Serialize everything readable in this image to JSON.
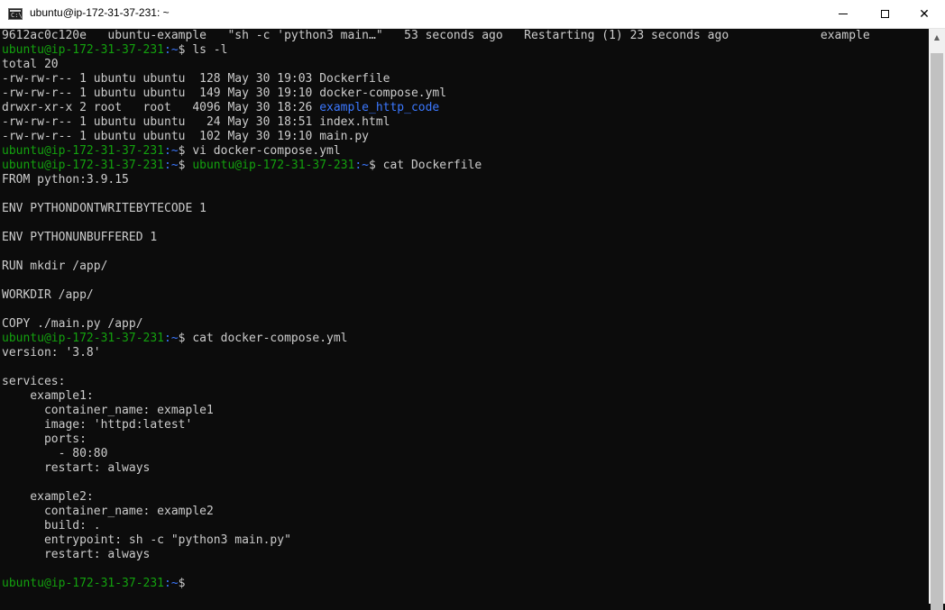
{
  "window": {
    "title": "ubuntu@ip-172-31-37-231: ~",
    "icon_text": "C:\\",
    "close_glyph": "✕",
    "scroll_up_glyph": "▲"
  },
  "prompt": {
    "user_host": "ubuntu@ip-172-31-37-231",
    "path_marker": ":~",
    "dollar": "$ "
  },
  "terminal": {
    "lines": [
      [
        {
          "t": "9612ac0c120e   ubuntu-example   \"sh -c 'python3 main…\"   53 seconds ago   Restarting (1) 23 seconds ago             example",
          "c": "w"
        }
      ],
      [
        {
          "t": "ubuntu@ip-172-31-37-231",
          "c": "g"
        },
        {
          "t": ":~",
          "c": "b"
        },
        {
          "t": "$ ls -l",
          "c": "w"
        }
      ],
      [
        {
          "t": "total 20",
          "c": "w"
        }
      ],
      [
        {
          "t": "-rw-rw-r-- 1 ubuntu ubuntu  128 May 30 19:03 Dockerfile",
          "c": "w"
        }
      ],
      [
        {
          "t": "-rw-rw-r-- 1 ubuntu ubuntu  149 May 30 19:10 docker-compose.yml",
          "c": "w"
        }
      ],
      [
        {
          "t": "drwxr-xr-x 2 root   root   4096 May 30 18:26 ",
          "c": "w"
        },
        {
          "t": "example_http_code",
          "c": "b"
        }
      ],
      [
        {
          "t": "-rw-rw-r-- 1 ubuntu ubuntu   24 May 30 18:51 index.html",
          "c": "w"
        }
      ],
      [
        {
          "t": "-rw-rw-r-- 1 ubuntu ubuntu  102 May 30 19:10 main.py",
          "c": "w"
        }
      ],
      [
        {
          "t": "ubuntu@ip-172-31-37-231",
          "c": "g"
        },
        {
          "t": ":~",
          "c": "b"
        },
        {
          "t": "$ vi docker-compose.yml",
          "c": "w"
        }
      ],
      [
        {
          "t": "ubuntu@ip-172-31-37-231",
          "c": "g"
        },
        {
          "t": ":~",
          "c": "b"
        },
        {
          "t": "$ ",
          "c": "w"
        },
        {
          "t": "ubuntu@ip-172-31-37-231",
          "c": "g"
        },
        {
          "t": ":~",
          "c": "b"
        },
        {
          "t": "$ cat Dockerfile",
          "c": "w"
        }
      ],
      [
        {
          "t": "FROM python:3.9.15",
          "c": "w"
        }
      ],
      [
        {
          "t": "",
          "c": "w"
        }
      ],
      [
        {
          "t": "ENV PYTHONDONTWRITEBYTECODE 1",
          "c": "w"
        }
      ],
      [
        {
          "t": "",
          "c": "w"
        }
      ],
      [
        {
          "t": "ENV PYTHONUNBUFFERED 1",
          "c": "w"
        }
      ],
      [
        {
          "t": "",
          "c": "w"
        }
      ],
      [
        {
          "t": "RUN mkdir /app/",
          "c": "w"
        }
      ],
      [
        {
          "t": "",
          "c": "w"
        }
      ],
      [
        {
          "t": "WORKDIR /app/",
          "c": "w"
        }
      ],
      [
        {
          "t": "",
          "c": "w"
        }
      ],
      [
        {
          "t": "COPY ./main.py /app/",
          "c": "w"
        }
      ],
      [
        {
          "t": "ubuntu@ip-172-31-37-231",
          "c": "g"
        },
        {
          "t": ":~",
          "c": "b"
        },
        {
          "t": "$ cat docker-compose.yml",
          "c": "w"
        }
      ],
      [
        {
          "t": "version: '3.8'",
          "c": "w"
        }
      ],
      [
        {
          "t": "",
          "c": "w"
        }
      ],
      [
        {
          "t": "services:",
          "c": "w"
        }
      ],
      [
        {
          "t": "    example1:",
          "c": "w"
        }
      ],
      [
        {
          "t": "      container_name: exmaple1",
          "c": "w"
        }
      ],
      [
        {
          "t": "      image: 'httpd:latest'",
          "c": "w"
        }
      ],
      [
        {
          "t": "      ports:",
          "c": "w"
        }
      ],
      [
        {
          "t": "        - 80:80",
          "c": "w"
        }
      ],
      [
        {
          "t": "      restart: always",
          "c": "w"
        }
      ],
      [
        {
          "t": "",
          "c": "w"
        }
      ],
      [
        {
          "t": "    example2:",
          "c": "w"
        }
      ],
      [
        {
          "t": "      container_name: example2",
          "c": "w"
        }
      ],
      [
        {
          "t": "      build: .",
          "c": "w"
        }
      ],
      [
        {
          "t": "      entrypoint: sh -c \"python3 main.py\"",
          "c": "w"
        }
      ],
      [
        {
          "t": "      restart: always",
          "c": "w"
        }
      ],
      [
        {
          "t": "",
          "c": "w"
        }
      ],
      [
        {
          "t": "ubuntu@ip-172-31-37-231",
          "c": "g"
        },
        {
          "t": ":~",
          "c": "b"
        },
        {
          "t": "$",
          "c": "w"
        }
      ]
    ]
  }
}
